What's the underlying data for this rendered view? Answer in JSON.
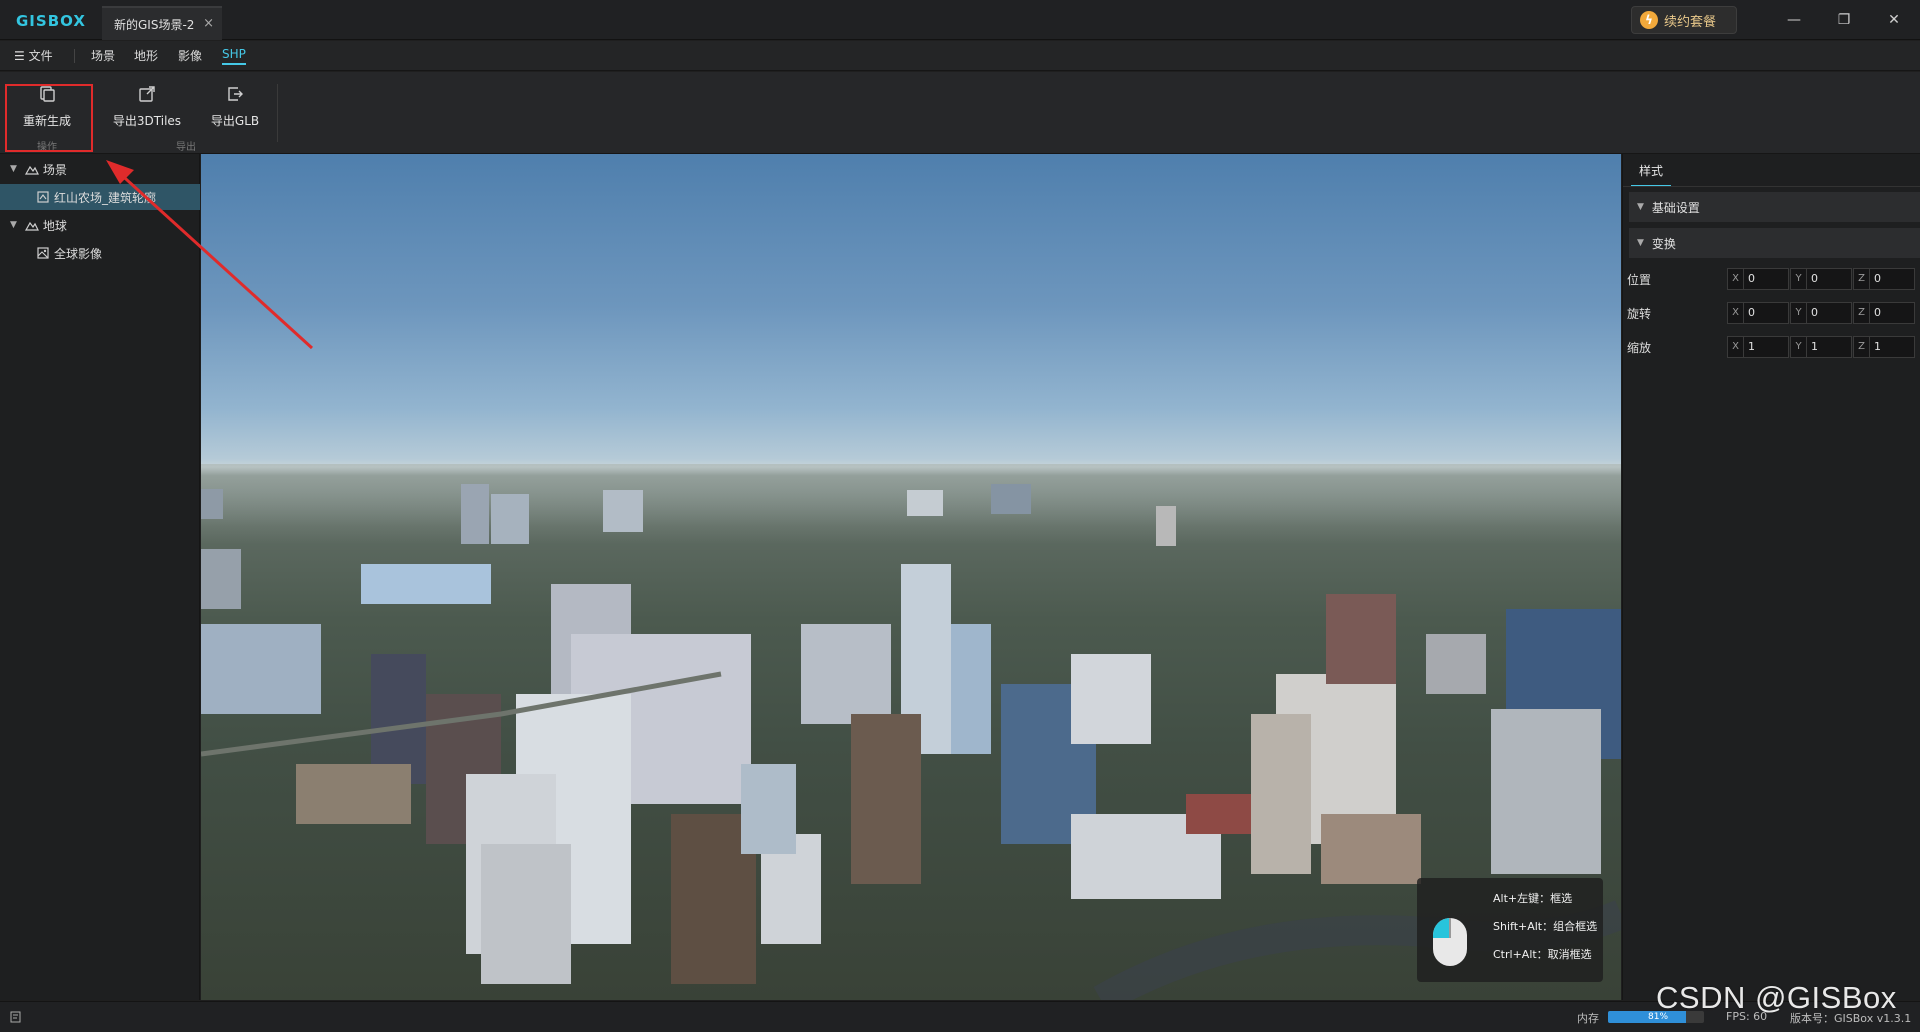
{
  "app": {
    "logo": "GISBOX",
    "doc_tab": "新的GIS场景-2",
    "doc_tab_close": "×",
    "upgrade_label": "续约套餐"
  },
  "window": {
    "minimize": "—",
    "restore": "❐",
    "close": "✕"
  },
  "menu": {
    "file": "文件",
    "items": [
      "场景",
      "地形",
      "影像",
      "SHP"
    ],
    "active": "SHP"
  },
  "ribbon": {
    "buttons": [
      {
        "label": "重新生成",
        "icon": "copy-icon"
      },
      {
        "label": "导出3DTiles",
        "icon": "external-link-icon"
      },
      {
        "label": "导出GLB",
        "icon": "export-icon"
      }
    ],
    "groups": [
      "操作",
      "导出"
    ]
  },
  "tree": [
    {
      "label": "场景",
      "type": "group",
      "expanded": true
    },
    {
      "label": "红山农场_建筑轮廓",
      "type": "item",
      "selected": true
    },
    {
      "label": "地球",
      "type": "group",
      "expanded": true
    },
    {
      "label": "全球影像",
      "type": "item",
      "selected": false
    }
  ],
  "properties": {
    "tab": "样式",
    "sections": [
      "基础设置",
      "变换"
    ],
    "rows": [
      {
        "label": "位置",
        "x": "0",
        "y": "0",
        "z": "0"
      },
      {
        "label": "旋转",
        "x": "0",
        "y": "0",
        "z": "0"
      },
      {
        "label": "缩放",
        "x": "1",
        "y": "1",
        "z": "1"
      }
    ],
    "axes": [
      "X",
      "Y",
      "Z"
    ]
  },
  "mouse_tips": [
    "Alt+左键：框选",
    "Shift+Alt：组合框选",
    "Ctrl+Alt：取消框选"
  ],
  "status": {
    "memory_label": "内存",
    "memory_percent": "81%",
    "memory_fraction": 0.81,
    "fps": "FPS: 60",
    "version": "版本号：GISBox v1.3.1"
  },
  "watermark": "CSDN @GISBox",
  "colors": {
    "accent": "#45c8e6",
    "highlight": "#e02b2b",
    "selected": "#2f5566"
  }
}
